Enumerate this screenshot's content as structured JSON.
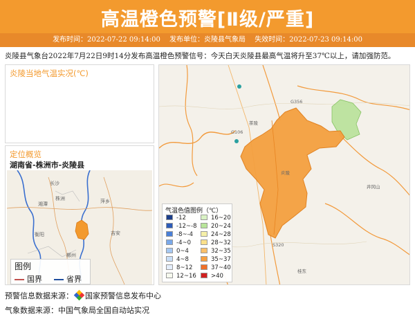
{
  "header": {
    "title": "高温橙色预警[Ⅱ级/严重]",
    "publish_time": "发布时间：2022-07-22 09:14:00",
    "publisher": "发布单位：炎陵县气象局",
    "expire_time": "失效时间：2022-07-23 09:14:00"
  },
  "notice": "炎陵县气象台2022年7月22日9时14分发布高温橙色预警信号：今天白天炎陵县最高气温将升至37℃以上，请加强防范。",
  "temp_panel": {
    "title": "炎陵当地气温实况(℃)"
  },
  "location_panel": {
    "title": "定位概览",
    "path": "湖南省-株洲市-炎陵县",
    "map_labels": [
      "长沙",
      "株洲",
      "湘潭",
      "衡阳",
      "郴州",
      "吉安",
      "萍乡"
    ],
    "legend": {
      "title": "图例",
      "items": [
        {
          "label": "国界",
          "color": "#c0504d"
        },
        {
          "label": "省界",
          "color": "#1f4e9e"
        }
      ]
    }
  },
  "main_map": {
    "labels": [
      "茶陵",
      "炎陵",
      "井冈山",
      "桂东",
      "G106",
      "G356",
      "S320"
    ],
    "scale": {
      "title": "气温色值图例（℃）",
      "items": [
        {
          "label": "-12",
          "color": "#1c3f8a"
        },
        {
          "label": "-12~-8",
          "color": "#2d5cb8"
        },
        {
          "label": "-8~-4",
          "color": "#4a80d8"
        },
        {
          "label": "-4~0",
          "color": "#7aa9ea"
        },
        {
          "label": "0~4",
          "color": "#a5c8f2"
        },
        {
          "label": "4~8",
          "color": "#c8def7"
        },
        {
          "label": "8~12",
          "color": "#e4eefb"
        },
        {
          "label": "12~16",
          "color": "#f6f9ee"
        },
        {
          "label": "16~20",
          "color": "#d9f2c4"
        },
        {
          "label": "20~24",
          "color": "#b8e59a"
        },
        {
          "label": "24~28",
          "color": "#f6f0a8"
        },
        {
          "label": "28~32",
          "color": "#fbe08a"
        },
        {
          "label": "32~35",
          "color": "#fbc06a"
        },
        {
          "label": "35~37",
          "color": "#f7a040"
        },
        {
          "label": "37~40",
          "color": "#f07028"
        },
        {
          "label": ">40",
          "color": "#d02020"
        }
      ]
    }
  },
  "footer": {
    "warning_source": "预警信息数据来源：",
    "warning_source_name": "国家预警信息发布中心",
    "weather_source": "气象数据来源：中国气象局全国自动站实况"
  }
}
